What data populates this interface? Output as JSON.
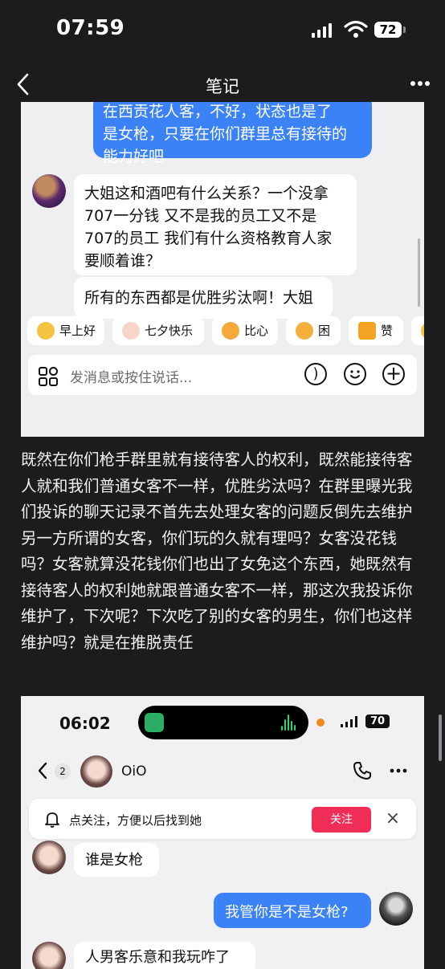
{
  "status_bar": {
    "time": "07:59",
    "battery": "72"
  },
  "nav": {
    "title": "笔记"
  },
  "screenshot1": {
    "blue_bubble_lines": [
      "在西贡花人客，不好，状态也是了",
      "是女枪，只要在你们群里总有接待的",
      "能力好吧"
    ],
    "white_bubble1_lines": [
      "大姐这和酒吧有什么关系？一个没拿",
      "707一分钱 又不是我的员工又不是",
      "707的员工 我们有什么资格教育人家",
      "要顺着谁？"
    ],
    "white_bubble2": "所有的东西都是优胜劣汰啊！大姐",
    "quick_replies": [
      "早上好",
      "七夕快乐",
      "比心",
      "困",
      "赞"
    ],
    "input_placeholder": "发消息或按住说话..."
  },
  "body_text": "既然在你们枪手群里就有接待客人的权利，既然能接待客人就和我们普通女客不一样，优胜劣汰吗？在群里曝光我们投诉的聊天记录不首先去处理女客的问题反倒先去维护另一方所谓的女客，你们玩的久就有理吗？女客没花钱吗？女客就算没花钱你们也出了女免这个东西，她既然有接待客人的权利她就跟普通女客不一样，那这次我投诉你维护了，下次呢？下次吃了别的女客的男生，你们也这样维护吗？就是在推脱责任",
  "screenshot2": {
    "time": "06:02",
    "battery": "70",
    "unread_count": "2",
    "contact_name": "OiO",
    "notice_text": "点关注，方便以后找到她",
    "follow_label": "关注",
    "msg1": "谁是女枪",
    "msg2": "我管你是不是女枪?",
    "msg3": "人男客乐意和我玩咋了"
  },
  "colors": {
    "accent_blue": "#3b82f6",
    "follow_red": "#f02d57"
  }
}
